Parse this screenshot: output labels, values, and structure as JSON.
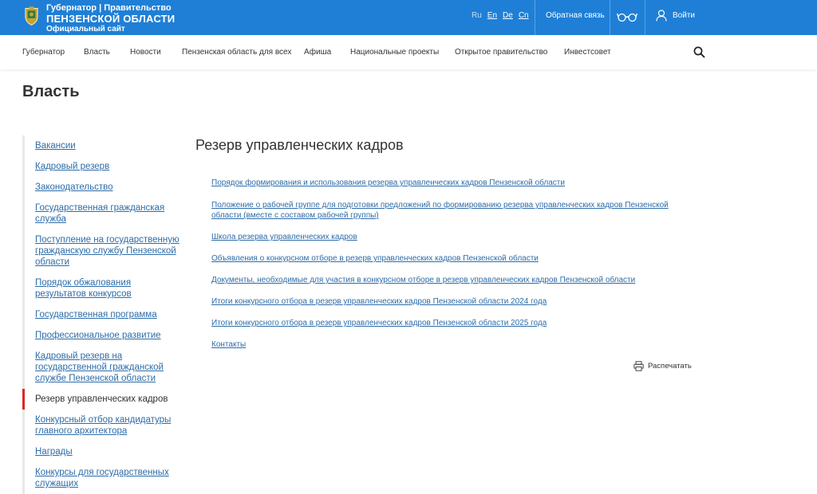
{
  "header": {
    "logo_line1": "Губернатор | Правительство",
    "logo_line2": "ПЕНЗЕНСКОЙ ОБЛАСТИ",
    "logo_line3": "Официальный сайт",
    "langs": [
      "Ru",
      "En",
      "De",
      "Cn"
    ],
    "active_lang": "Ru",
    "feedback": "Обратная связь",
    "accessibility_icon": "glasses-icon",
    "login": "Войти",
    "brand_color": "#1f7fd6"
  },
  "nav": {
    "items": [
      "Губернатор",
      "Власть",
      "Новости",
      "Пензенская область для всех",
      "Афиша",
      "Национальные проекты",
      "Открытое правительство",
      "Инвестсовет"
    ],
    "search_icon": "search-icon"
  },
  "page": {
    "title": "Власть"
  },
  "sidebar": {
    "items": [
      "Вакансии",
      "Кадровый резерв",
      "Законодательство",
      "Государственная гражданская служба",
      "Поступление на государственную гражданскую службу Пензенской области",
      "Порядок обжалования результатов конкурсов",
      "Государственная программа",
      "Профессиональное развитие",
      "Кадровый резерв на государственной гражданской службе Пензенской области",
      "Резерв управленческих кадров",
      "Конкурсный отбор кандидатуры главного архитектора",
      "Награды",
      "Конкурсы для государственных служащих"
    ],
    "active_index": 9,
    "accent_color": "#d72b1f"
  },
  "content": {
    "title": "Резерв управленческих кадров",
    "links": [
      "Порядок формирования и использования резерва управленческих кадров Пензенской области",
      "Положение о рабочей группе для подготовки предложений по формированию резерва управленческих кадров Пензенской области (вместе с составом рабочей группы)",
      "Школа резерва управленческих кадров",
      "Объявления о конкурсном отборе в резерв управленческих кадров Пензенской области",
      "Документы, необходимые для участия в конкурсном отборе в резерв управленческих кадров Пензенской области",
      "Итоги конкурсного отбора в резерв управленческих кадров Пензенской области 2024 года",
      "Итоги конкурсного отбора в резерв управленческих кадров Пензенской области 2025 года",
      "Контакты"
    ],
    "print_label": "Распечатать",
    "link_color": "#2d6ca8"
  }
}
